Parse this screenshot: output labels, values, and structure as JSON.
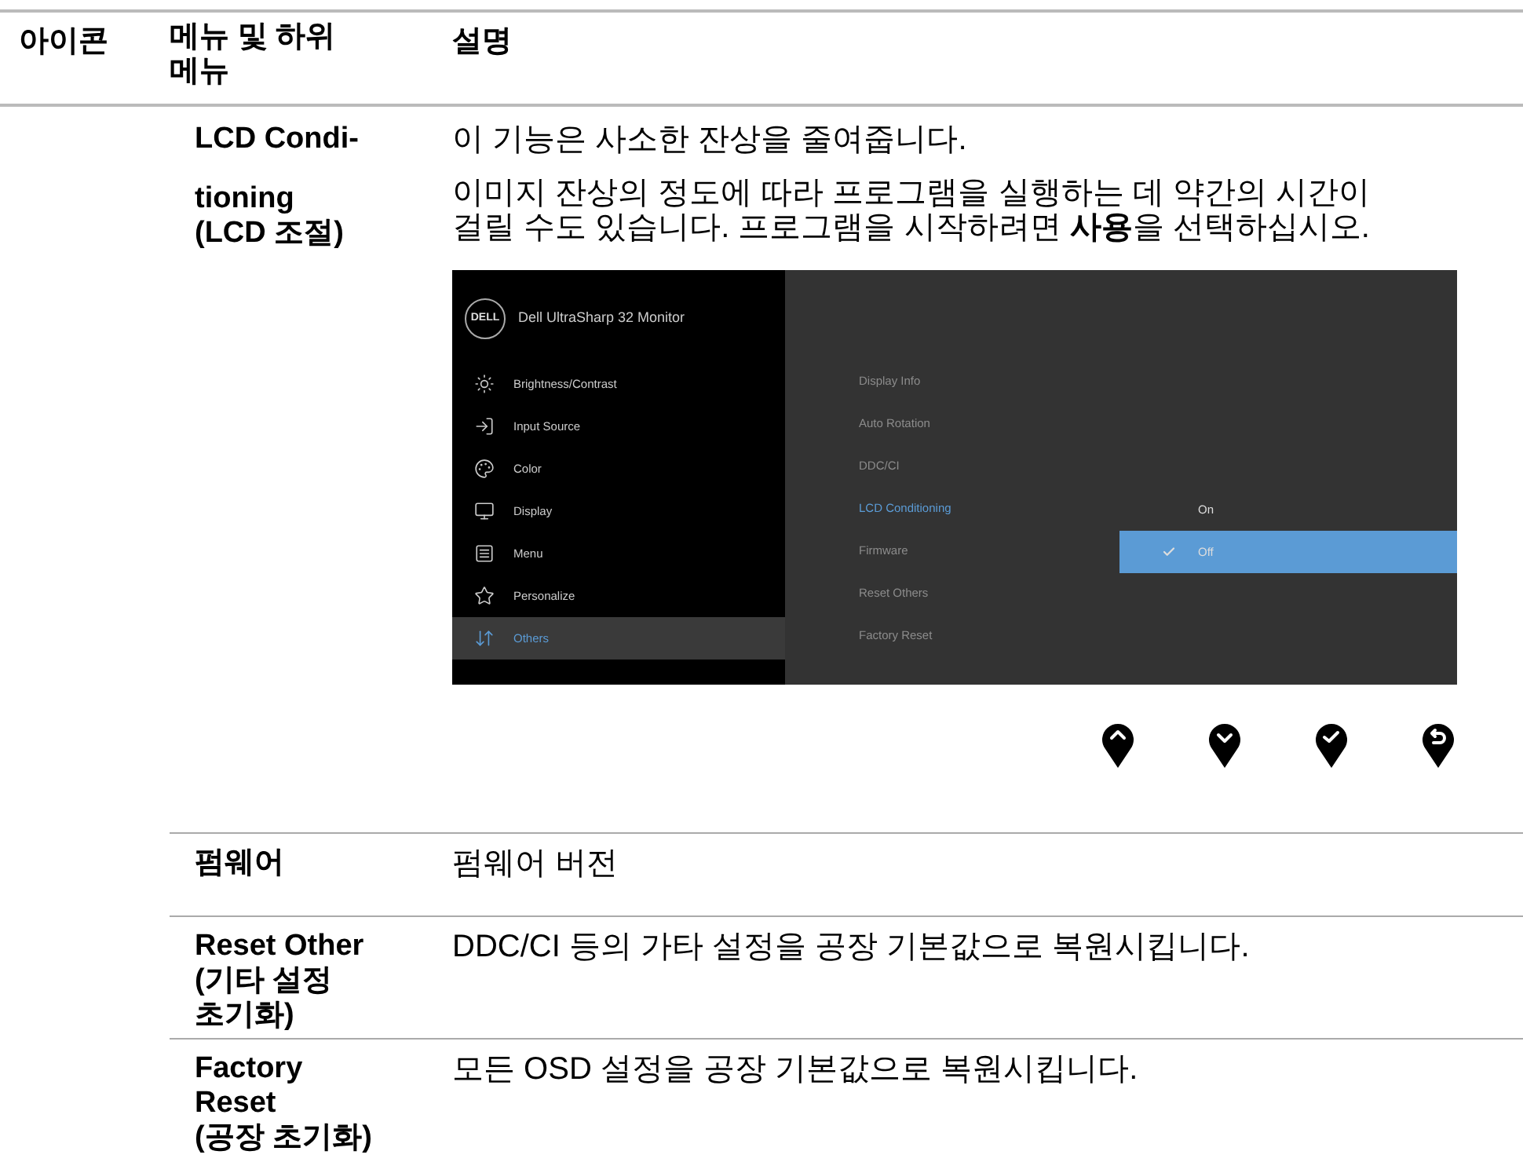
{
  "header": {
    "icon": "아이콘",
    "menu": "메뉴 및 하위 메뉴",
    "description": "설명"
  },
  "rows": [
    {
      "kind": "osd",
      "name_lines": [
        "LCD Condi-",
        "tioning",
        "(LCD 조절)"
      ],
      "paragraphs": [
        "이 기능은 사소한 잔상을 줄여줍니다.",
        "이미지 잔상의 정도에 따라 프로그램을 실행하는 데 약간의 시간이 걸릴 수도 있습니다. 프로그램을 시작하려면 **사용**을 선택하십시오."
      ]
    },
    {
      "kind": "text",
      "name_lines": [
        "펌웨어"
      ],
      "paragraphs": [
        "펌웨어 버전"
      ]
    },
    {
      "kind": "text",
      "name_lines": [
        "Reset Other",
        "(기타 설정",
        "초기화)"
      ],
      "paragraphs": [
        "DDC/CI 등의 가타 설정을 공장 기본값으로 복원시킵니다."
      ]
    },
    {
      "kind": "text",
      "name_lines": [
        "Factory",
        "Reset",
        "(공장 초기화)"
      ],
      "paragraphs": [
        "모든 OSD 설정을 공장 기본값으로 복원시킵니다."
      ]
    }
  ],
  "osd": {
    "logo": "DELL",
    "title": "Dell UltraSharp 32 Monitor",
    "menu": [
      {
        "label": "Brightness/Contrast",
        "selected": false
      },
      {
        "label": "Input Source",
        "selected": false
      },
      {
        "label": "Color",
        "selected": false
      },
      {
        "label": "Display",
        "selected": false
      },
      {
        "label": "Menu",
        "selected": false
      },
      {
        "label": "Personalize",
        "selected": false
      },
      {
        "label": "Others",
        "selected": true
      }
    ],
    "submenu": [
      {
        "label": "Display Info",
        "selected": false
      },
      {
        "label": "Auto Rotation",
        "selected": false
      },
      {
        "label": "DDC/CI",
        "selected": false
      },
      {
        "label": "LCD Conditioning",
        "selected": true
      },
      {
        "label": "Firmware",
        "selected": false
      },
      {
        "label": "Reset Others",
        "selected": false
      },
      {
        "label": "Factory Reset",
        "selected": false
      }
    ],
    "options": [
      {
        "label": "On",
        "selected": false
      },
      {
        "label": "Off",
        "selected": true
      }
    ]
  },
  "buttons": [
    {
      "kind": "up"
    },
    {
      "kind": "down"
    },
    {
      "kind": "check"
    },
    {
      "kind": "back"
    }
  ]
}
